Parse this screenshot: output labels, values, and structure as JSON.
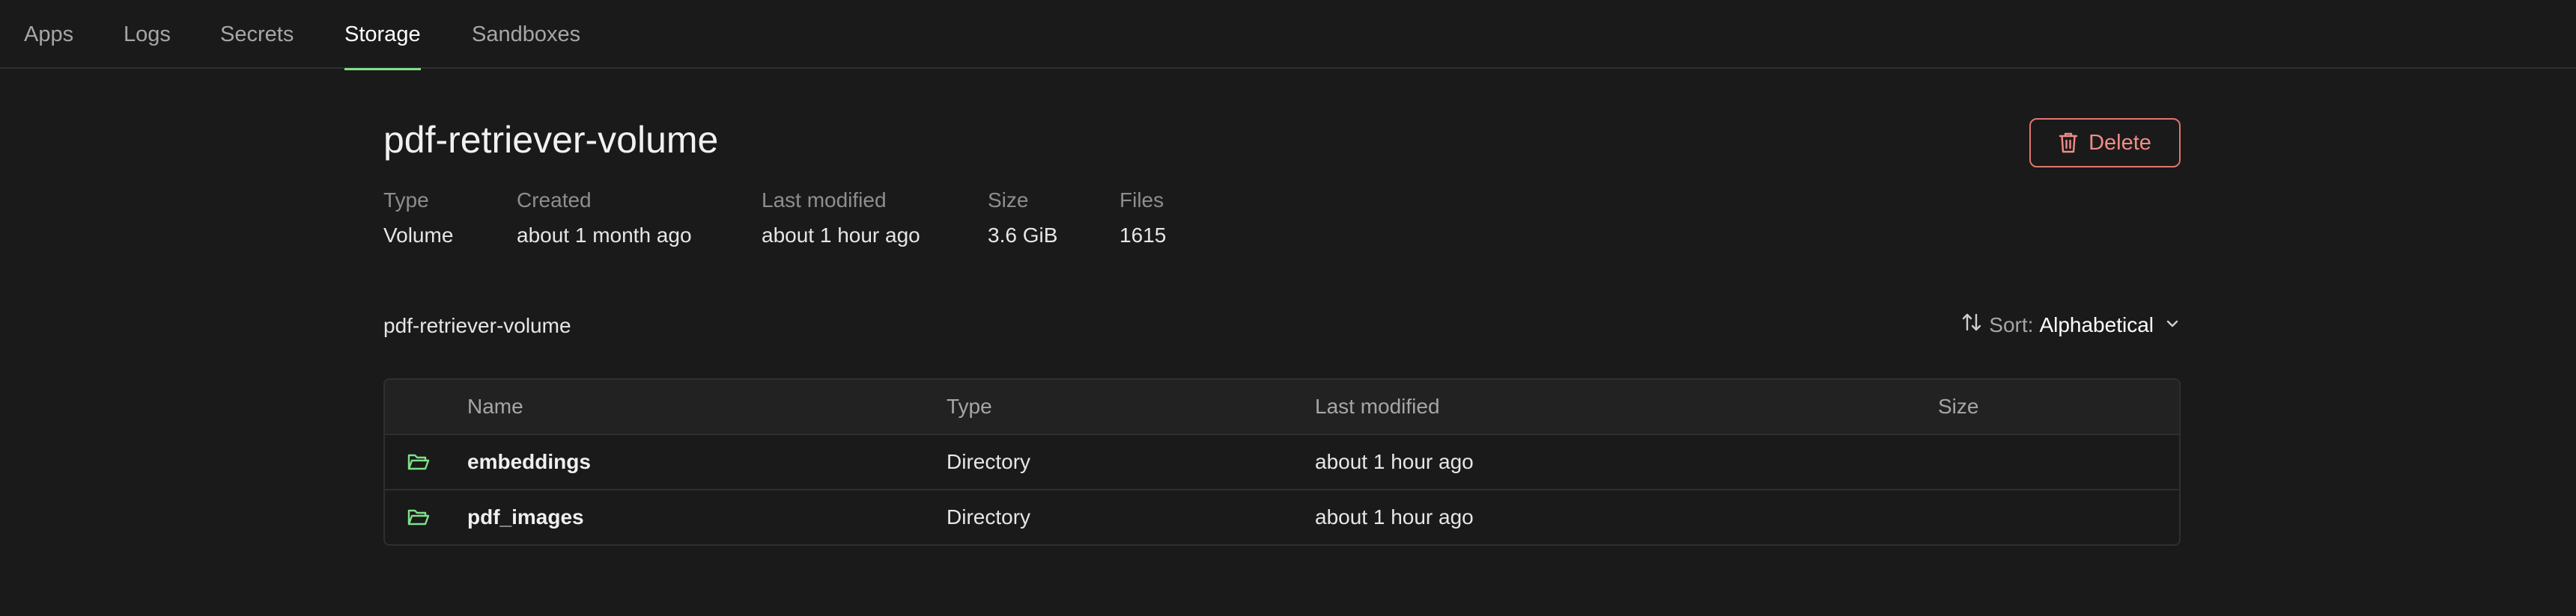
{
  "nav": {
    "tabs": [
      {
        "label": "Apps"
      },
      {
        "label": "Logs"
      },
      {
        "label": "Secrets"
      },
      {
        "label": "Storage",
        "active": true
      },
      {
        "label": "Sandboxes"
      }
    ]
  },
  "volume": {
    "title": "pdf-retriever-volume",
    "delete_label": "Delete",
    "meta": {
      "type_label": "Type",
      "type_value": "Volume",
      "created_label": "Created",
      "created_value": "about 1 month ago",
      "modified_label": "Last modified",
      "modified_value": "about 1 hour ago",
      "size_label": "Size",
      "size_value": "3.6 GiB",
      "files_label": "Files",
      "files_value": "1615"
    }
  },
  "browser": {
    "path": "pdf-retriever-volume",
    "sort_prefix": "Sort:",
    "sort_value": "Alphabetical",
    "columns": {
      "name": "Name",
      "type": "Type",
      "modified": "Last modified",
      "size": "Size"
    },
    "rows": [
      {
        "icon": "folder-open-icon",
        "name": "embeddings",
        "type": "Directory",
        "modified": "about 1 hour ago",
        "size": ""
      },
      {
        "icon": "folder-open-icon",
        "name": "pdf_images",
        "type": "Directory",
        "modified": "about 1 hour ago",
        "size": ""
      }
    ]
  },
  "colors": {
    "background": "#1a1a1a",
    "active_tab_underline": "#7fe08a",
    "delete_accent": "#e0756f",
    "folder_icon": "#7fe08a"
  }
}
